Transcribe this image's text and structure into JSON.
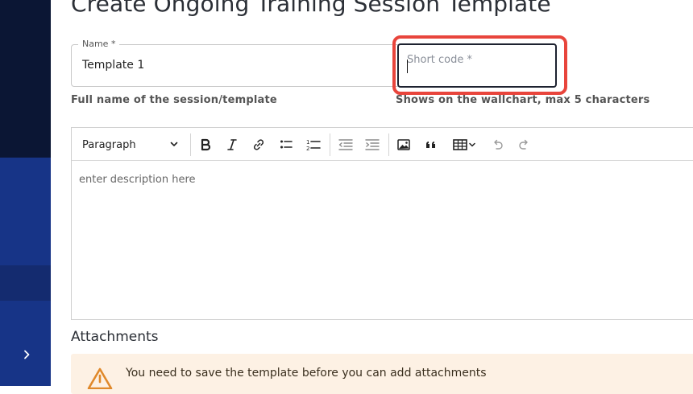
{
  "page": {
    "title": "Create Ongoing Training Session Template"
  },
  "form": {
    "name": {
      "label": "Name *",
      "value": "Template 1",
      "helper": "Full name of the session/template"
    },
    "short_code": {
      "placeholder": "Short code *",
      "value": "",
      "helper": "Shows on the wallchart, max 5 characters"
    }
  },
  "editor": {
    "paragraph_style": "Paragraph",
    "toolbar_icons": [
      "bold-icon",
      "italic-icon",
      "link-icon",
      "bulleted-list-icon",
      "numbered-list-icon",
      "outdent-icon",
      "indent-icon",
      "image-icon",
      "quote-icon",
      "table-icon",
      "undo-icon",
      "redo-icon"
    ],
    "placeholder": "enter description here"
  },
  "attachments": {
    "title": "Attachments",
    "warning": "You need to save the template before you can add attachments"
  },
  "colors": {
    "sidebar_dark": "#0b1634",
    "sidebar_blue": "#173487",
    "highlight_red": "#e8453c",
    "warning_bg": "#fdf1e4",
    "warning_icon": "#e0892b"
  }
}
